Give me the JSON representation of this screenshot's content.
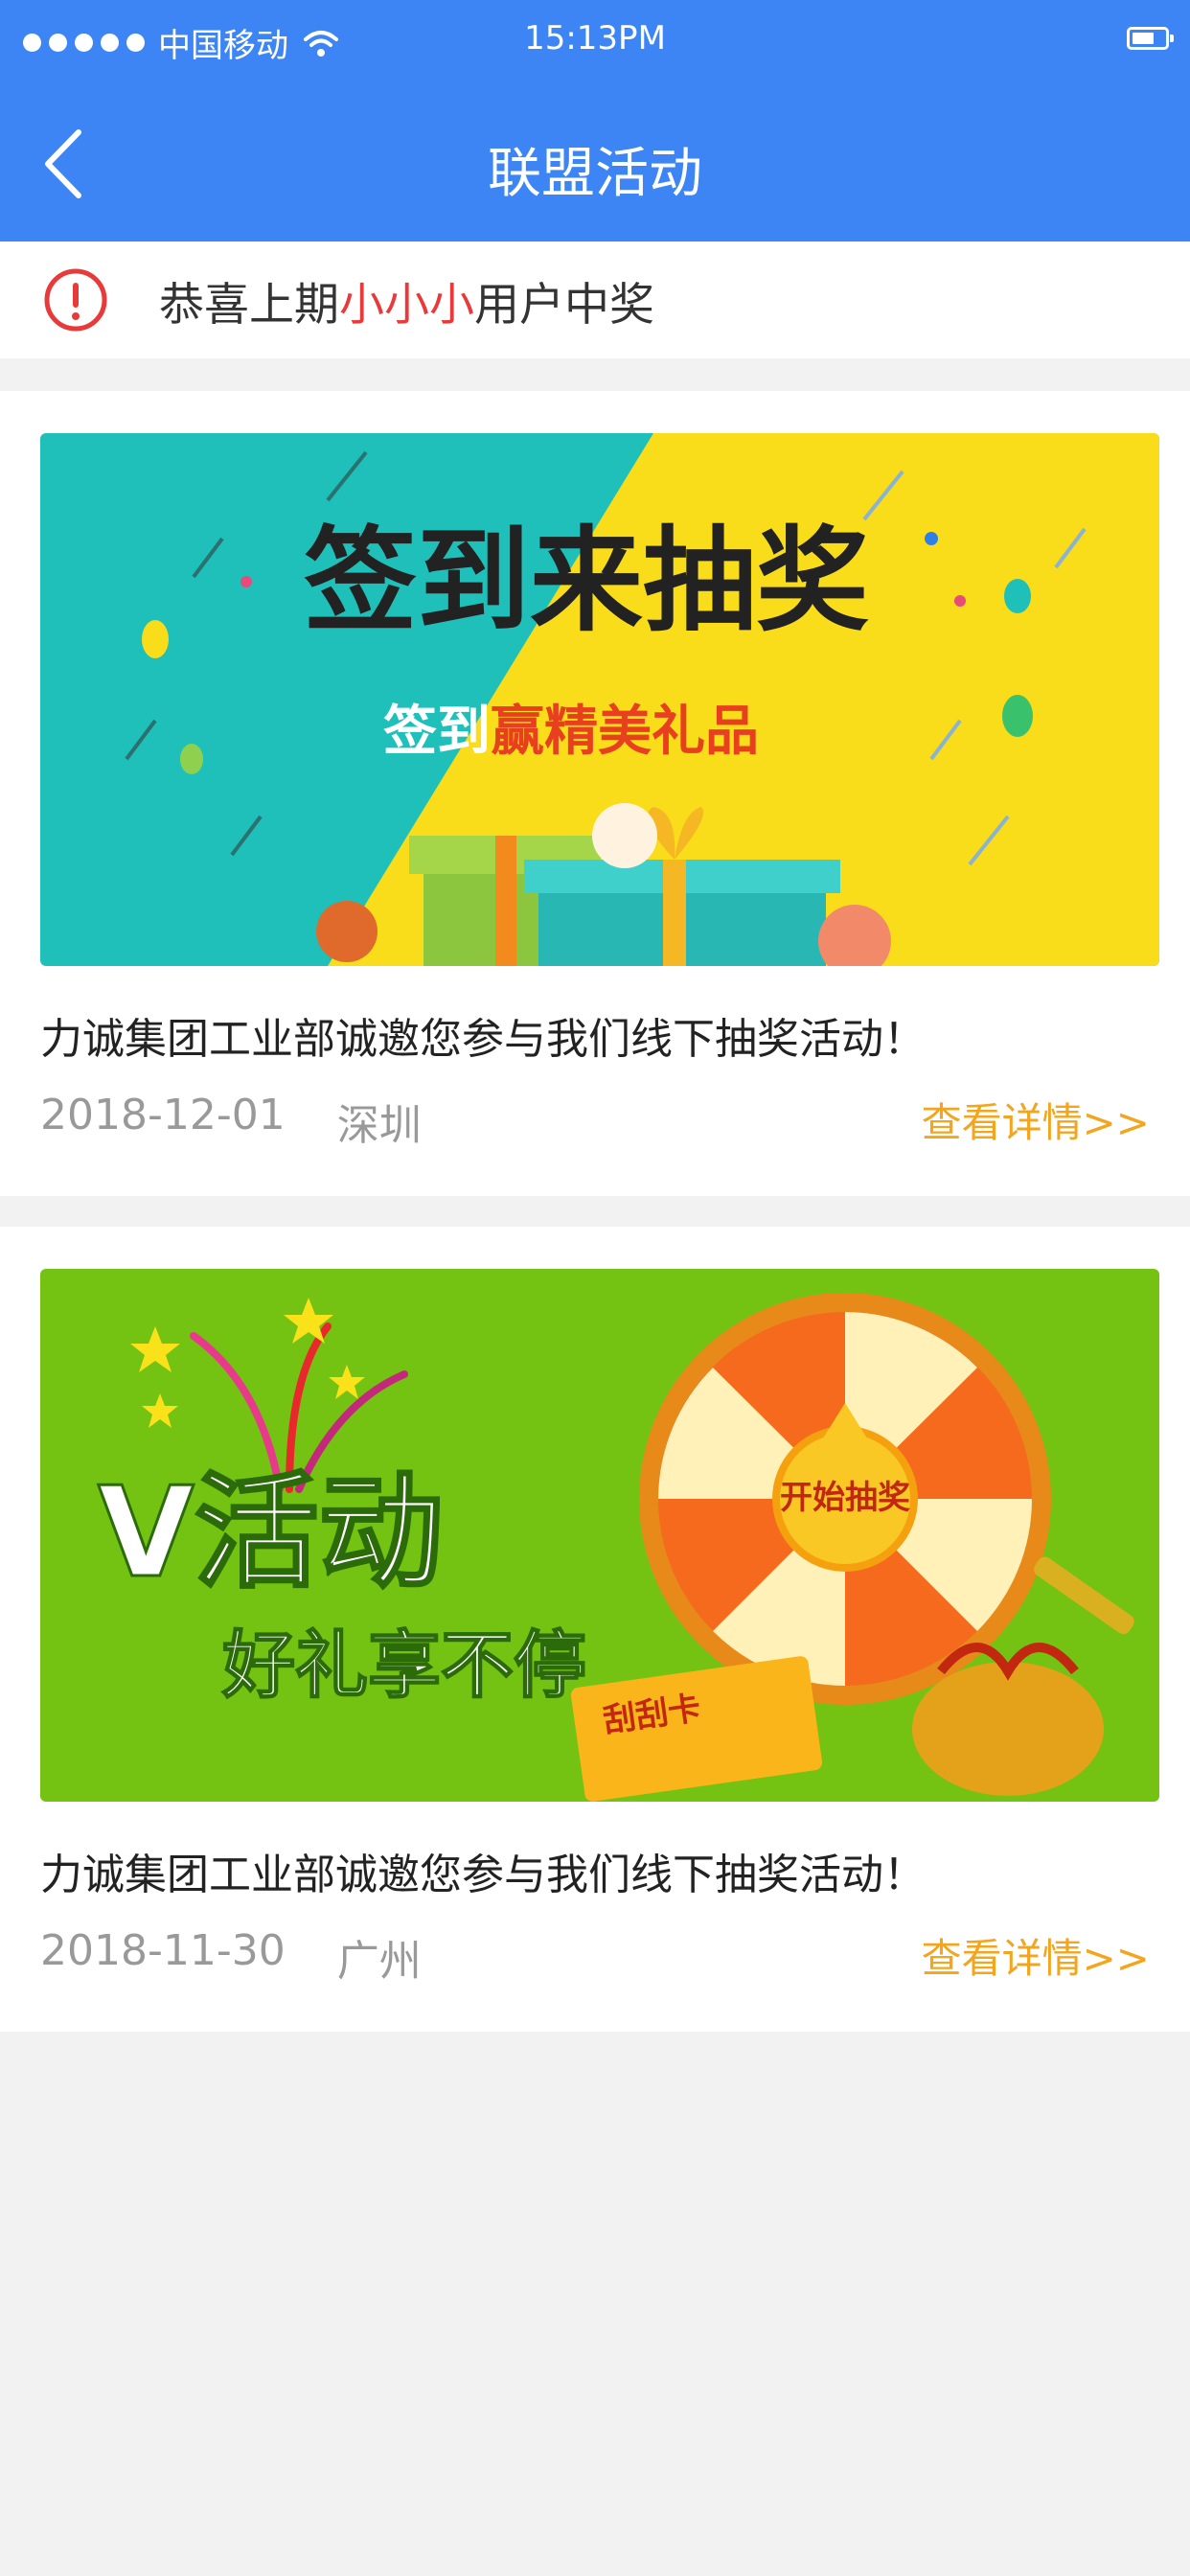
{
  "status_bar": {
    "carrier": "中国移动",
    "time": "15:13PM"
  },
  "nav": {
    "title": "联盟活动"
  },
  "notice": {
    "prefix": "恭喜上期",
    "highlight": "小小小",
    "suffix": "用户中奖"
  },
  "activities": [
    {
      "banner": {
        "headline": "签到来抽奖",
        "sub_white": "签到",
        "sub_red": "赢精美礼品"
      },
      "title": "力诚集团工业部诚邀您参与我们线下抽奖活动！",
      "date": "2018-12-01",
      "city": "深圳",
      "link": "查看详情>>"
    },
    {
      "banner": {
        "headline": "V活动",
        "sub": "好礼享不停",
        "wheel_center": "开始抽奖",
        "card_label": "刮刮卡"
      },
      "title": "力诚集团工业部诚邀您参与我们线下抽奖活动！",
      "date": "2018-11-30",
      "city": "广州",
      "link": "查看详情>>"
    }
  ],
  "colors": {
    "primary": "#3d85f5",
    "accent": "#f3a51d",
    "alert": "#e83a3a"
  }
}
